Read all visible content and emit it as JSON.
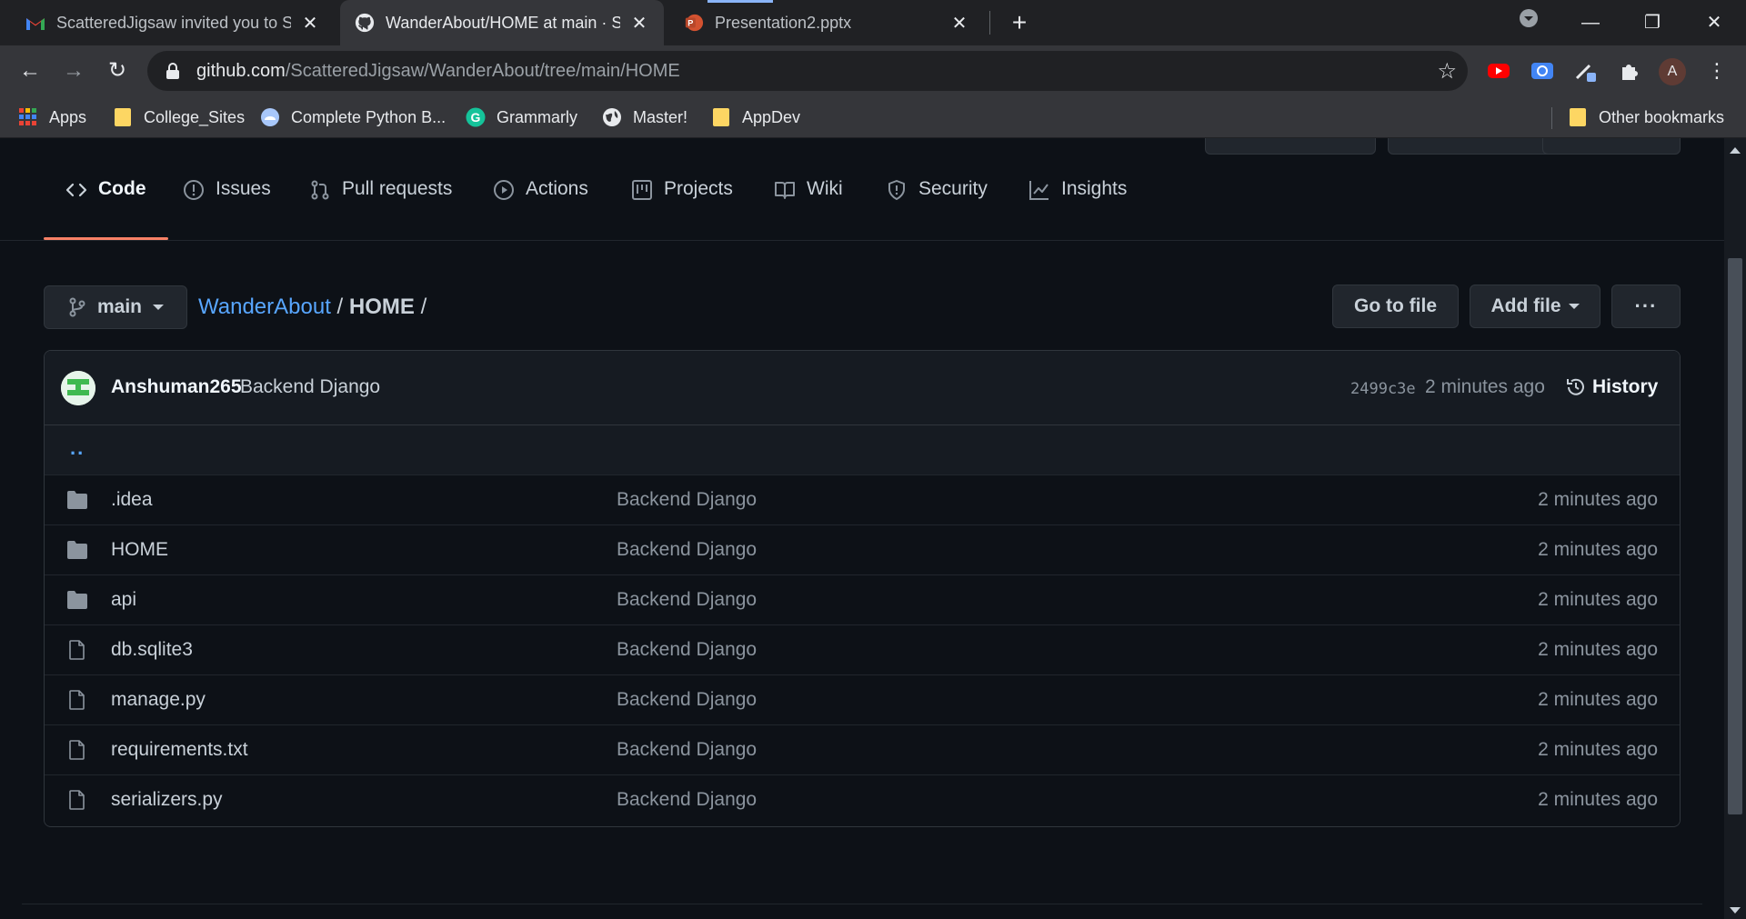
{
  "browser": {
    "tabs": [
      {
        "title": "ScatteredJigsaw invited you to Sc",
        "favicon": "gmail-icon",
        "active": false
      },
      {
        "title": "WanderAbout/HOME at main · Sc",
        "favicon": "github-icon",
        "active": true
      },
      {
        "title": "Presentation2.pptx",
        "favicon": "powerpoint-icon",
        "active": false
      }
    ],
    "url_host": "github.com",
    "url_path": "/ScatteredJigsaw/WanderAbout/tree/main/HOME",
    "profile_initial": "A",
    "bookmarks": [
      {
        "label": "Apps",
        "icon": "apps-grid-icon"
      },
      {
        "label": "College_Sites",
        "icon": "folder-icon"
      },
      {
        "label": "Complete Python B...",
        "icon": "site-icon"
      },
      {
        "label": "Grammarly",
        "icon": "grammarly-icon"
      },
      {
        "label": "Master!",
        "icon": "globe-icon"
      },
      {
        "label": "AppDev",
        "icon": "folder-icon"
      }
    ],
    "other_bookmarks": "Other bookmarks"
  },
  "repo_nav": {
    "tabs": [
      {
        "label": "Code",
        "icon": "code-icon",
        "selected": true
      },
      {
        "label": "Issues",
        "icon": "issue-icon",
        "selected": false
      },
      {
        "label": "Pull requests",
        "icon": "pull-request-icon",
        "selected": false
      },
      {
        "label": "Actions",
        "icon": "play-icon",
        "selected": false
      },
      {
        "label": "Projects",
        "icon": "project-icon",
        "selected": false
      },
      {
        "label": "Wiki",
        "icon": "book-icon",
        "selected": false
      },
      {
        "label": "Security",
        "icon": "shield-icon",
        "selected": false
      },
      {
        "label": "Insights",
        "icon": "graph-icon",
        "selected": false
      }
    ]
  },
  "breadcrumb": {
    "branch": "main",
    "repo": "WanderAbout",
    "sep1": "/",
    "current": "HOME",
    "sep2": "/"
  },
  "actions": {
    "go_to_file": "Go to file",
    "add_file": "Add file",
    "more": "···"
  },
  "latest_commit": {
    "author": "Anshuman265",
    "message": "Backend Django",
    "sha": "2499c3e",
    "time": "2 minutes ago",
    "history_label": "History"
  },
  "parent_dir": "..",
  "files": [
    {
      "name": ".idea",
      "type": "dir",
      "message": "Backend Django",
      "time": "2 minutes ago"
    },
    {
      "name": "HOME",
      "type": "dir",
      "message": "Backend Django",
      "time": "2 minutes ago"
    },
    {
      "name": "api",
      "type": "dir",
      "message": "Backend Django",
      "time": "2 minutes ago"
    },
    {
      "name": "db.sqlite3",
      "type": "file",
      "message": "Backend Django",
      "time": "2 minutes ago"
    },
    {
      "name": "manage.py",
      "type": "file",
      "message": "Backend Django",
      "time": "2 minutes ago"
    },
    {
      "name": "requirements.txt",
      "type": "file",
      "message": "Backend Django",
      "time": "2 minutes ago"
    },
    {
      "name": "serializers.py",
      "type": "file",
      "message": "Backend Django",
      "time": "2 minutes ago"
    }
  ],
  "colors": {
    "accent_link": "#58a6ff",
    "selected_tab_underline": "#f78166",
    "page_bg": "#0d1117"
  }
}
